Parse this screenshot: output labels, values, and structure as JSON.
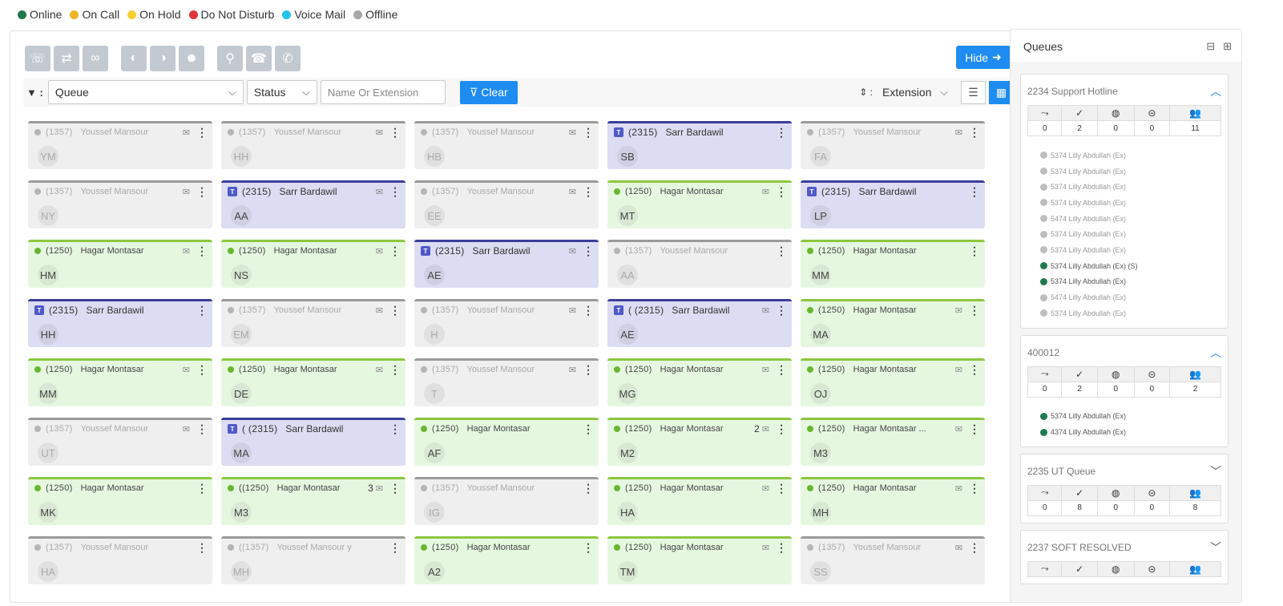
{
  "legend": [
    {
      "label": "Online",
      "color": "#1f7a4d"
    },
    {
      "label": "On Call",
      "color": "#f0b429"
    },
    {
      "label": "On Hold",
      "color": "#f5d02f"
    },
    {
      "label": "Do Not Disturb",
      "color": "#e0343d"
    },
    {
      "label": "Voice Mail",
      "color": "#20c5e8"
    },
    {
      "label": "Offline",
      "color": "#a6a6a6"
    }
  ],
  "toolbar": {
    "hide_label": "Hide"
  },
  "filters": {
    "queue": "Queue",
    "status": "Status",
    "name_placeholder": "Name Or Extension",
    "clear_label": "Clear",
    "sort_label": "Extension"
  },
  "agents": [
    {
      "state": "offline",
      "ext": "(1357)",
      "name": "Youssef Mansour",
      "initials": "YM",
      "mail": true
    },
    {
      "state": "offline",
      "ext": "(1357)",
      "name": "Youssef Mansour",
      "initials": "HH",
      "mail": true
    },
    {
      "state": "offline",
      "ext": "(1357)",
      "name": "Youssef Mansour",
      "initials": "HB",
      "mail": true
    },
    {
      "state": "teams",
      "ext": "(2315)",
      "name": "Sarr Bardawil",
      "initials": "SB",
      "mail": false
    },
    {
      "state": "offline",
      "ext": "(1357)",
      "name": "Youssef Mansour",
      "initials": "FA",
      "mail": true
    },
    {
      "state": "offline",
      "ext": "(1357)",
      "name": "Youssef Mansour",
      "initials": "NY",
      "mail": true
    },
    {
      "state": "teams",
      "ext": "(2315)",
      "name": "Sarr Bardawil",
      "initials": "AA",
      "mail": true
    },
    {
      "state": "offline",
      "ext": "(1357)",
      "name": "Youssef Mansour",
      "initials": "EE",
      "mail": true
    },
    {
      "state": "online",
      "ext": "(1250)",
      "name": "Hagar Montasar",
      "initials": "MT",
      "mail": true
    },
    {
      "state": "teams",
      "ext": "(2315)",
      "name": "Sarr Bardawil",
      "initials": "LP",
      "mail": false
    },
    {
      "state": "online",
      "ext": "(1250)",
      "name": "Hagar Montasar",
      "initials": "HM",
      "mail": true
    },
    {
      "state": "online",
      "ext": "(1250)",
      "name": "Hagar Montasar",
      "initials": "NS",
      "mail": true
    },
    {
      "state": "teams",
      "ext": "(2315)",
      "name": "Sarr Bardawil",
      "initials": "AE",
      "mail": true
    },
    {
      "state": "offline",
      "ext": "(1357)",
      "name": "Youssef Mansour",
      "initials": "AA",
      "mail": false
    },
    {
      "state": "online",
      "ext": "(1250)",
      "name": "Hagar Montasar",
      "initials": "MM",
      "mail": false
    },
    {
      "state": "teams",
      "ext": "(2315)",
      "name": "Sarr Bardawil",
      "initials": "HH",
      "mail": false
    },
    {
      "state": "offline",
      "ext": "(1357)",
      "name": "Youssef Mansour",
      "initials": "EM",
      "mail": true
    },
    {
      "state": "offline",
      "ext": "(1357)",
      "name": "Youssef Mansour",
      "initials": "H",
      "mail": true
    },
    {
      "state": "teams",
      "ext": "( (2315)",
      "name": "Sarr Bardawil",
      "initials": "AE",
      "mail": true
    },
    {
      "state": "online",
      "ext": "(1250)",
      "name": "Hagar Montasar",
      "initials": "MA",
      "mail": true
    },
    {
      "state": "online",
      "ext": "(1250)",
      "name": "Hagar Montasar",
      "initials": "MM",
      "mail": true
    },
    {
      "state": "online",
      "ext": "(1250)",
      "name": "Hagar Montasar",
      "initials": "DE",
      "mail": true
    },
    {
      "state": "offline",
      "ext": "(1357)",
      "name": "Youssef Mansour",
      "initials": "T",
      "mail": true
    },
    {
      "state": "online",
      "ext": "(1250)",
      "name": "Hagar Montasar",
      "initials": "MG",
      "mail": true
    },
    {
      "state": "online",
      "ext": "(1250)",
      "name": "Hagar Montasar",
      "initials": "OJ",
      "mail": true
    },
    {
      "state": "offline",
      "ext": "(1357)",
      "name": "Youssef Mansour",
      "initials": "UT",
      "mail": true
    },
    {
      "state": "teams",
      "ext": "( (2315)",
      "name": "Sarr Bardawil",
      "initials": "MA",
      "mail": false
    },
    {
      "state": "online",
      "ext": "(1250)",
      "name": "Hagar Montasar",
      "initials": "AF",
      "mail": false
    },
    {
      "state": "online",
      "ext": "(1250)",
      "name": "Hagar Montasar",
      "initials": "M2",
      "mail": true,
      "count": "2"
    },
    {
      "state": "online",
      "ext": "(1250)",
      "name": "Hagar Montasar ...",
      "initials": "M3",
      "mail": true
    },
    {
      "state": "online",
      "ext": "(1250)",
      "name": "Hagar Montasar",
      "initials": "MK",
      "mail": false
    },
    {
      "state": "online",
      "ext": "((1250)",
      "name": "Hagar Montasar",
      "initials": "M3",
      "mail": true,
      "count": "3"
    },
    {
      "state": "offline",
      "ext": "(1357)",
      "name": "Youssef Mansour",
      "initials": "IG",
      "mail": false
    },
    {
      "state": "online",
      "ext": "(1250)",
      "name": "Hagar Montasar",
      "initials": "HA",
      "mail": true
    },
    {
      "state": "online",
      "ext": "(1250)",
      "name": "Hagar Montasar",
      "initials": "MH",
      "mail": true
    },
    {
      "state": "offline",
      "ext": "(1357)",
      "name": "Youssef Mansour",
      "initials": "HA",
      "mail": false
    },
    {
      "state": "offline",
      "ext": "((1357)",
      "name": "Youssef Mansour y",
      "initials": "MH",
      "mail": false
    },
    {
      "state": "online",
      "ext": "(1250)",
      "name": "Hagar Montasar",
      "initials": "A2",
      "mail": false
    },
    {
      "state": "online",
      "ext": "(1250)",
      "name": "Hagar Montasar",
      "initials": "TM",
      "mail": true
    },
    {
      "state": "offline",
      "ext": "(1357)",
      "name": "Youssef Mansour",
      "initials": "SS",
      "mail": true
    }
  ],
  "queues": {
    "title": "Queues",
    "items": [
      {
        "name": "2234 Support Hotline",
        "expanded": true,
        "stats": [
          "0",
          "2",
          "0",
          "0",
          "11"
        ],
        "agents": [
          {
            "label": "5374 Lilly Abdullah (Ex)",
            "online": false
          },
          {
            "label": "5374 Lilly Abdullah (Ex)",
            "online": false
          },
          {
            "label": "5374 Lilly Abdullah (Ex)",
            "online": false
          },
          {
            "label": "5374 Lilly Abdullah (Ex)",
            "online": false
          },
          {
            "label": "5474 Lilly Abdullah (Ex)",
            "online": false
          },
          {
            "label": "5374 Lilly Abdullah (Ex)",
            "online": false
          },
          {
            "label": "5374 Lilly Abdullah (Ex)",
            "online": false
          },
          {
            "label": "5374 Lilly Abdullah (Ex) (S)",
            "online": true
          },
          {
            "label": "5374 Lilly Abdullah (Ex)",
            "online": true
          },
          {
            "label": "5474 Lilly Abdullah (Ex)",
            "online": false
          },
          {
            "label": "5374 Lilly Abdullah (Ex)",
            "online": false
          }
        ]
      },
      {
        "name": "400012",
        "expanded": true,
        "stats": [
          "0",
          "2",
          "0",
          "0",
          "2"
        ],
        "agents": [
          {
            "label": "5374 Lilly Abdullah (Ex)",
            "online": true
          },
          {
            "label": "4374 Lilly Abdullah (Ex)",
            "online": true
          }
        ]
      },
      {
        "name": "2235 UT Queue",
        "expanded": false,
        "stats": [
          "0",
          "8",
          "0",
          "0",
          "8"
        ],
        "agents": []
      },
      {
        "name": "2237 SOFT RESOLVED",
        "expanded": false,
        "stats": [],
        "agents": []
      }
    ]
  }
}
